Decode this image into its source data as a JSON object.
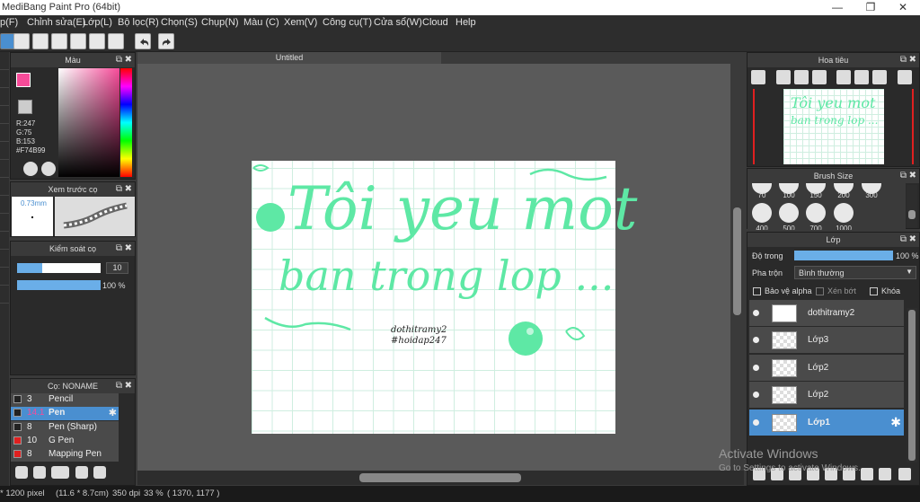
{
  "app": {
    "title": "MediBang Paint Pro (64bit)",
    "min": "—",
    "max": "❐",
    "close": "✕"
  },
  "menu": [
    "p(F)",
    "Chỉnh sửa(E)",
    "Lớp(L)",
    "Bộ lọc(R)",
    "Chọn(S)",
    "Chụp(N)",
    "Màu (C)",
    "Xem(V)",
    "Công cụ(T)",
    "Cửa sổ(W)",
    "Cloud",
    "Help"
  ],
  "document": {
    "tab": "Untitled",
    "text_line1": "Tôi yeu mot",
    "text_line2": "ban trong lop ...",
    "sig1": "dothitramy2",
    "sig2": "#hoidap247"
  },
  "color_panel": {
    "title": "Màu",
    "r": "R:247",
    "g": "G:75",
    "b": "B:153",
    "hex": "#F74B99",
    "accent": "#F74B99"
  },
  "preview_panel": {
    "title": "Xem trước cọ",
    "size": "0.73mm"
  },
  "control_panel": {
    "title": "Kiểm soát cọ",
    "size_value": "10",
    "opacity_value": "100 %",
    "size_fraction": 0.3,
    "opacity_fraction": 1.0
  },
  "brush_panel": {
    "title": "Cọ: NONAME",
    "items": [
      {
        "size": "3",
        "name": "Pencil",
        "swatch": "#222222"
      },
      {
        "size": "14.1",
        "name": "Pen",
        "swatch": "#222222"
      },
      {
        "size": "8",
        "name": "Pen (Sharp)",
        "swatch": "#222222"
      },
      {
        "size": "10",
        "name": "G Pen",
        "swatch": "#e02020"
      },
      {
        "size": "8",
        "name": "Mapping Pen",
        "swatch": "#e02020"
      }
    ]
  },
  "navigator": {
    "title": "Hoa tiêu"
  },
  "brush_size": {
    "title": "Brush Size",
    "row1": [
      "70",
      "100",
      "150",
      "200",
      "300"
    ],
    "row2": [
      "400",
      "500",
      "700",
      "1000"
    ]
  },
  "layers": {
    "title": "Lớp",
    "opacity_label": "Độ trong",
    "opacity_value": "100 %",
    "blend_label": "Pha trộn",
    "blend_value": "Bình thường",
    "protect_alpha": "Bảo vệ alpha",
    "clipping": "Xén bớt",
    "lock": "Khóa",
    "items": [
      "dothitramy2",
      "Lớp3",
      "Lớp2",
      "Lớp2",
      "Lớp1"
    ]
  },
  "status": {
    "size": "* 1200 pixel",
    "cm": "(11.6 * 8.7cm)",
    "dpi": "350 dpi",
    "zoom": "33 %",
    "coords": "( 1370, 1177 )"
  },
  "watermark": {
    "line1": "Activate Windows",
    "line2": "Go to Settings to activate Windows."
  },
  "colors": {
    "ink": "#5ee8a5",
    "grid": "#cfeee0",
    "selected": "#4a8fd0"
  }
}
